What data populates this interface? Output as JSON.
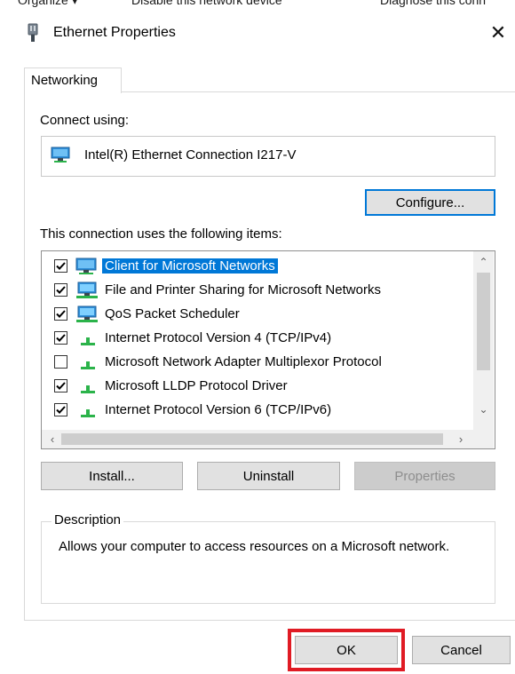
{
  "background_window": {
    "fragments": [
      "Organize ▾",
      "Disable this network device",
      "Diagnose this conn"
    ]
  },
  "window": {
    "title": "Ethernet Properties",
    "title_icon": "network-adapter-icon",
    "close_glyph": "✕"
  },
  "tabs": [
    {
      "label": "Networking",
      "active": true
    }
  ],
  "connect_using": {
    "label": "Connect using:",
    "adapter_name": "Intel(R) Ethernet Connection I217-V",
    "adapter_icon": "network-adapter-icon"
  },
  "buttons": {
    "configure": "Configure...",
    "install": "Install...",
    "uninstall": "Uninstall",
    "properties": "Properties",
    "ok": "OK",
    "cancel": "Cancel"
  },
  "items_label": "This connection uses the following items:",
  "items": [
    {
      "label": "Client for Microsoft Networks",
      "checked": true,
      "selected": true,
      "icon": "network-client-icon"
    },
    {
      "label": "File and Printer Sharing for Microsoft Networks",
      "checked": true,
      "selected": false,
      "icon": "network-service-icon"
    },
    {
      "label": "QoS Packet Scheduler",
      "checked": true,
      "selected": false,
      "icon": "network-service-icon"
    },
    {
      "label": "Internet Protocol Version 4 (TCP/IPv4)",
      "checked": true,
      "selected": false,
      "icon": "protocol-icon"
    },
    {
      "label": "Microsoft Network Adapter Multiplexor Protocol",
      "checked": false,
      "selected": false,
      "icon": "protocol-icon"
    },
    {
      "label": "Microsoft LLDP Protocol Driver",
      "checked": true,
      "selected": false,
      "icon": "protocol-icon"
    },
    {
      "label": "Internet Protocol Version 6 (TCP/IPv6)",
      "checked": true,
      "selected": false,
      "icon": "protocol-icon"
    }
  ],
  "scroll_glyphs": {
    "up": "⌃",
    "down": "⌄",
    "left": "‹",
    "right": "›"
  },
  "description": {
    "title": "Description",
    "text": "Allows your computer to access resources on a Microsoft network."
  },
  "colors": {
    "selection": "#0078d7",
    "focus_border": "#0078d7",
    "highlight_box": "#e01b24"
  }
}
